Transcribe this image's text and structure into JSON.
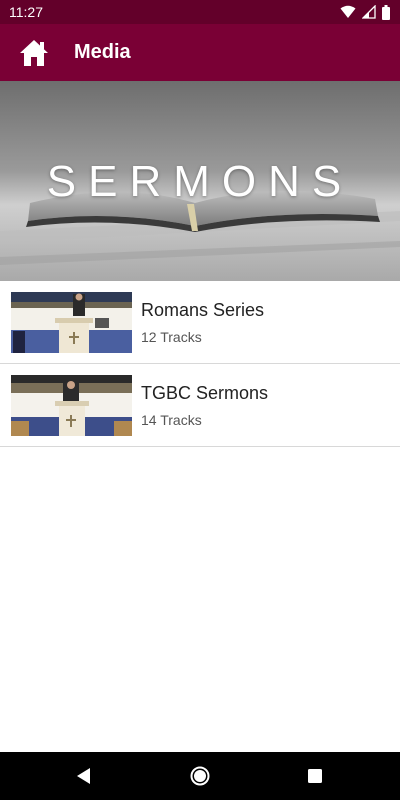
{
  "status": {
    "time": "11:27"
  },
  "app_bar": {
    "title": "Media",
    "home_icon": "home-icon"
  },
  "banner": {
    "text": "SERMONS"
  },
  "items": [
    {
      "title": "Romans Series",
      "subtitle": "12 Tracks"
    },
    {
      "title": "TGBC Sermons",
      "subtitle": "14 Tracks"
    }
  ],
  "colors": {
    "status_bar": "#63002a",
    "app_bar": "#7a0035",
    "nav_bar": "#000000"
  },
  "nav": {
    "back_icon": "back-icon",
    "home_icon": "home-circle-icon",
    "recents_icon": "recents-icon"
  }
}
